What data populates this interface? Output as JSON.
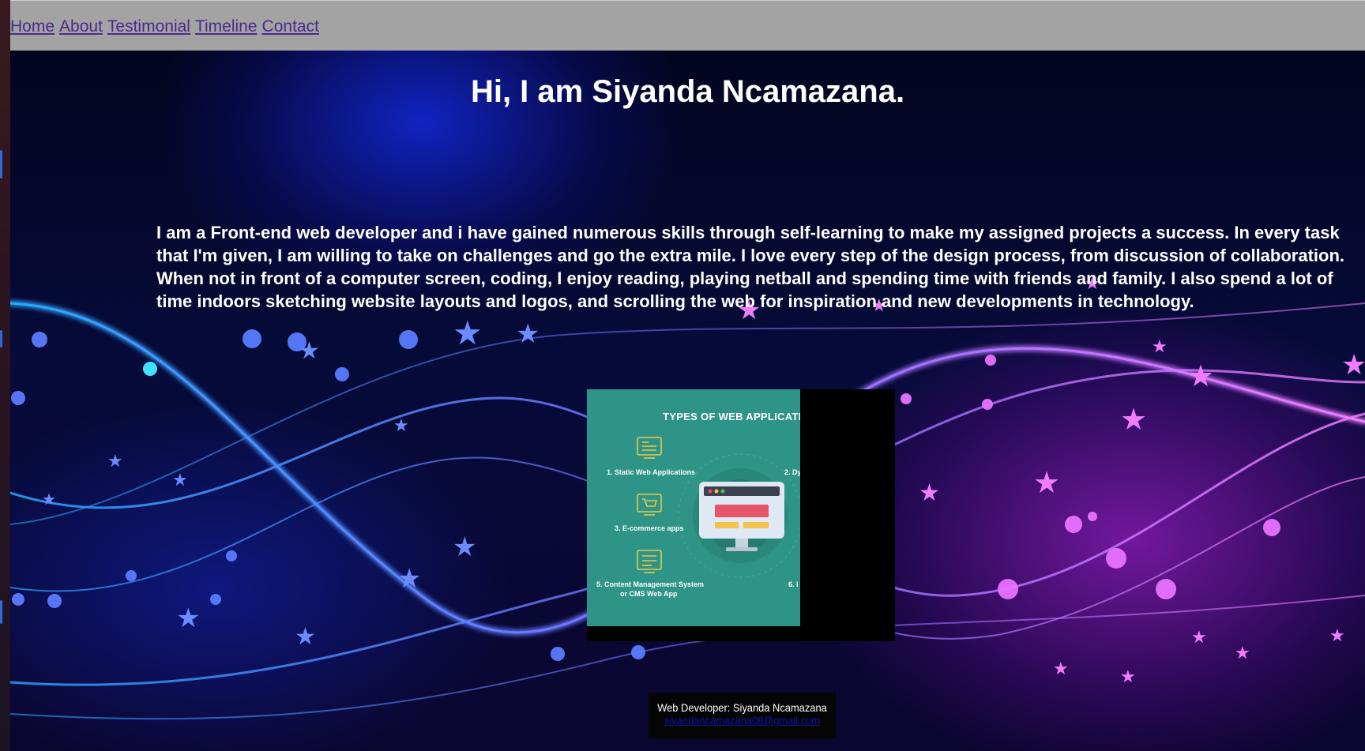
{
  "nav": {
    "links": [
      "Home",
      "About",
      "Testimonial",
      "Timeline",
      "Contact"
    ]
  },
  "hero": {
    "heading": "Hi, I am Siyanda Ncamazana.",
    "bio": "I am a Front-end web developer and i have gained numerous skills through self-learning to make my assigned projects a success. In every task that I'm given, I am willing to take on challenges and go the extra mile. I love every step of the design process, from discussion of collaboration. When not in front of a computer screen, coding, I enjoy reading, playing netball and spending time with friends and family. I also spend a lot of time indoors sketching website layouts and logos, and scrolling the web for inspiration and new developments in technology."
  },
  "infographic": {
    "title": "TYPES OF WEB APPLICATI",
    "items": [
      "1. Static Web Applications",
      "2. Dy",
      "3. E-commerce apps",
      "5. Content Management System",
      "or CMS Web App",
      "6. I"
    ]
  },
  "footer": {
    "credit": "Web Developer: Siyanda Ncamazana",
    "email": "siyandancamazana08@gmail.com"
  },
  "colors": {
    "nav_bg": "#a3a3a3",
    "nav_link": "#4a2a8e",
    "infographic_teal": "#2f9488",
    "footer_link": "#1010b0"
  }
}
